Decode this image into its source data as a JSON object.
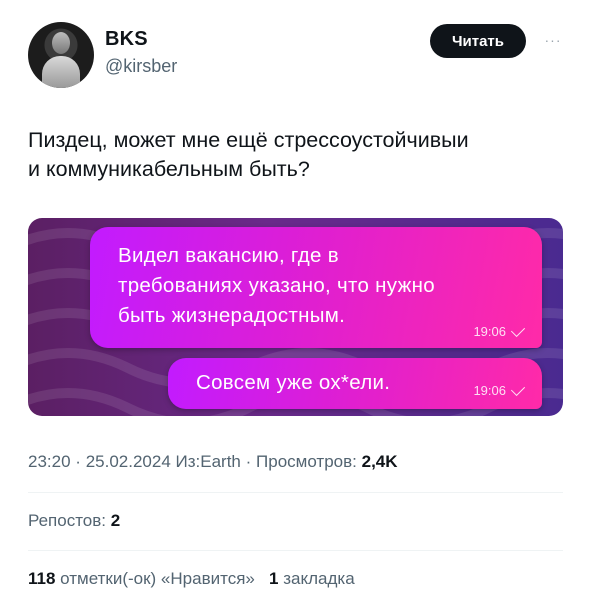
{
  "author": {
    "name": "BKS",
    "handle": "@kirsber"
  },
  "follow_button": {
    "label": "Читать"
  },
  "more_button": {
    "label": "···"
  },
  "tweet": {
    "text_line1": "Пиздец, может мне ещё стрессоустойчивыи",
    "text_line2": "и коммуникабельным быть?"
  },
  "media": {
    "messages": [
      {
        "lines": [
          "Видел вакансию, где в",
          "требованиях указано, что нужно",
          "быть жизнерадостным."
        ],
        "time": "19:06"
      },
      {
        "lines": [
          "Совсем уже ох*ели."
        ],
        "time": "19:06"
      }
    ],
    "colors": {
      "bubble_start": "#c21bff",
      "bubble_end": "#ff2aa8",
      "background": "#5b1f63"
    }
  },
  "meta": {
    "time": "23:20",
    "sep1": "·",
    "date": "25.02.2024",
    "source": "Из:Earth",
    "sep2": "·",
    "views_label": "Просмотров:",
    "views_count": "2,4K"
  },
  "reposts": {
    "label": "Репостов:",
    "count": "2"
  },
  "stats": {
    "likes_count": "118",
    "likes_label": "отметки(-ок) «Нравится»",
    "bookmarks_count": "1",
    "bookmarks_label": "закладка"
  }
}
